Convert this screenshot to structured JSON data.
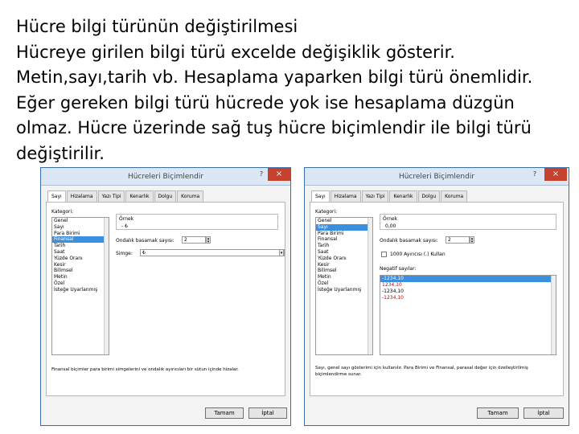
{
  "slide": {
    "lines": [
      "Hücre bilgi türünün değiştirilmesi",
      "Hücreye girilen bilgi türü excelde değişiklik gösterir.",
      "Metin,sayı,tarih vb. Hesaplama yaparken bilgi türü önemlidir.",
      "Eğer gereken bilgi türü hücrede yok ise hesaplama düzgün",
      "olmaz. Hücre üzerinde sağ tuş hücre biçimlendir ile  bilgi türü",
      "değiştirilir."
    ]
  },
  "dialogs": [
    {
      "title": "Hücreleri Biçimlendir",
      "help": "?",
      "close": "×",
      "tabs": [
        "Sayı",
        "Hizalama",
        "Yazı Tipi",
        "Kenarlık",
        "Dolgu",
        "Koruma"
      ],
      "category_label": "Kategori:",
      "categories": [
        "Genel",
        "Sayı",
        "Para Birimi",
        "Finansal",
        "Tarih",
        "Saat",
        "Yüzde Oranı",
        "Kesir",
        "Bilimsel",
        "Metin",
        "Özel",
        "İsteğe Uyarlanmış"
      ],
      "selected_category": "Finansal",
      "sample_label": "Örnek",
      "sample_value": "- ₺",
      "decimal_label": "Ondalık basamak sayısı:",
      "decimal_value": "2",
      "symbol_label": "Simge:",
      "symbol_value": "₺",
      "description": "Finansal biçimler para birimi simgelerini ve ondalık ayırıcıları bir sütun içinde hizalar.",
      "ok": "Tamam",
      "cancel": "İptal"
    },
    {
      "title": "Hücreleri Biçimlendir",
      "help": "?",
      "close": "×",
      "tabs": [
        "Sayı",
        "Hizalama",
        "Yazı Tipi",
        "Kenarlık",
        "Dolgu",
        "Koruma"
      ],
      "category_label": "Kategori:",
      "categories": [
        "Genel",
        "Sayı",
        "Para Birimi",
        "Finansal",
        "Tarih",
        "Saat",
        "Yüzde Oranı",
        "Kesir",
        "Bilimsel",
        "Metin",
        "Özel",
        "İsteğe Uyarlanmış"
      ],
      "selected_category": "Sayı",
      "sample_label": "Örnek",
      "sample_value": "0,00",
      "decimal_label": "Ondalık basamak sayısı:",
      "decimal_value": "2",
      "separator_label": "1000 Ayırıcısı (.) Kullan",
      "negative_label": "Negatif sayılar:",
      "negative_numbers": [
        "-1234,10",
        "1234,10",
        "-1234,10",
        "-1234,10"
      ],
      "negative_colors": [
        "#ffffff",
        "#cc0000",
        "#000000",
        "#cc0000"
      ],
      "description": "Sayı, genel sayı gösterimi için kullanılır. Para Birimi ve Finansal, parasal değer için özelleştirilmiş biçimlendirme sunar.",
      "ok": "Tamam",
      "cancel": "İptal"
    }
  ]
}
